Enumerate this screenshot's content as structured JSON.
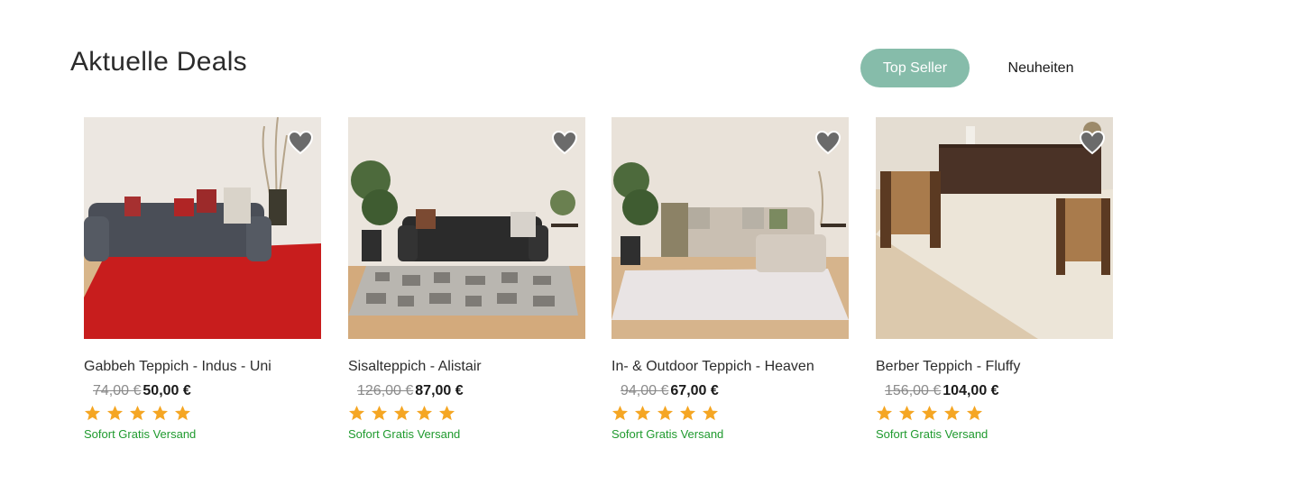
{
  "section": {
    "title": "Aktuelle Deals"
  },
  "tabs": [
    {
      "label": "Top Seller",
      "active": true
    },
    {
      "label": "Neuheiten",
      "active": false
    }
  ],
  "colors": {
    "accent": "#86bcaa",
    "star": "#f5a623",
    "shipping": "#1f9a2e"
  },
  "products": [
    {
      "name": "Gabbeh Teppich - Indus - Uni",
      "old_price": "74,00 €",
      "new_price": "50,00 €",
      "rating": 5,
      "shipping": "Sofort Gratis Versand",
      "rug_color": "#c81d1d",
      "sofa_color": "#4a4e57",
      "favorite_icon": "heart-icon"
    },
    {
      "name": "Sisalteppich - Alistair",
      "old_price": "126,00 €",
      "new_price": "87,00 €",
      "rating": 5,
      "shipping": "Sofort Gratis Versand",
      "rug_color": "#b9b6b0",
      "sofa_color": "#2b2b2b",
      "favorite_icon": "heart-icon"
    },
    {
      "name": "In- & Outdoor Teppich - Heaven",
      "old_price": "94,00 €",
      "new_price": "67,00 €",
      "rating": 5,
      "shipping": "Sofort Gratis Versand",
      "rug_color": "#e9e4e4",
      "sofa_color": "#c9bfb2",
      "favorite_icon": "heart-icon"
    },
    {
      "name": "Berber Teppich - Fluffy",
      "old_price": "156,00 €",
      "new_price": "104,00 €",
      "rating": 5,
      "shipping": "Sofort Gratis Versand",
      "rug_color": "#ece5d8",
      "sofa_color": "#4a3226",
      "favorite_icon": "heart-icon"
    }
  ]
}
